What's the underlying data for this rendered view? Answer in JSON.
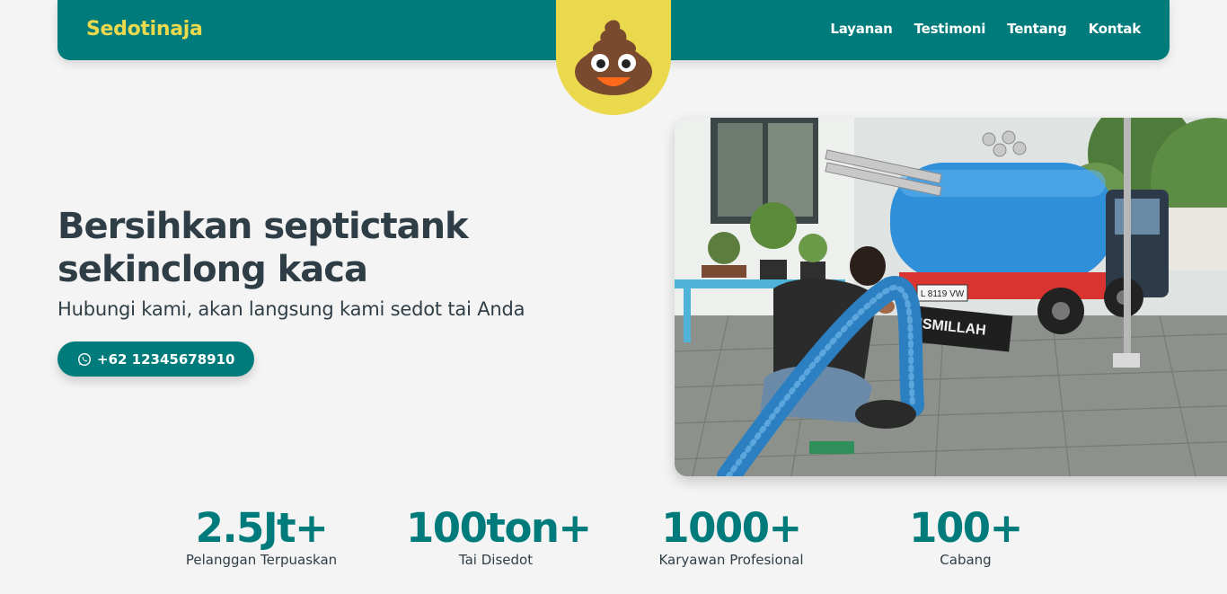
{
  "header": {
    "brand": "Sedotinaja",
    "nav": [
      "Layanan",
      "Testimoni",
      "Tentang",
      "Kontak"
    ],
    "logo_icon": "poop-emoji-icon"
  },
  "hero": {
    "title_line1": "Bersihkan septictank",
    "title_line2": "sekinclong kaca",
    "subtitle": "Hubungi kami, akan langsung kami sedot tai Anda",
    "phone_button": {
      "icon": "whatsapp-icon",
      "label": "+62 12345678910"
    },
    "image": {
      "plate_text": "L 8119 VW",
      "truck_text": "BISMILLAH"
    }
  },
  "stats": [
    {
      "value": "2.5Jt+",
      "label": "Pelanggan Terpuaskan"
    },
    {
      "value": "100ton+",
      "label": "Tai Disedot"
    },
    {
      "value": "1000+",
      "label": "Karyawan Profesional"
    },
    {
      "value": "100+",
      "label": "Cabang"
    }
  ],
  "colors": {
    "primary": "#007b7b",
    "accent": "#ead94c",
    "text": "#2f3e46",
    "background": "#f4f4f4"
  }
}
